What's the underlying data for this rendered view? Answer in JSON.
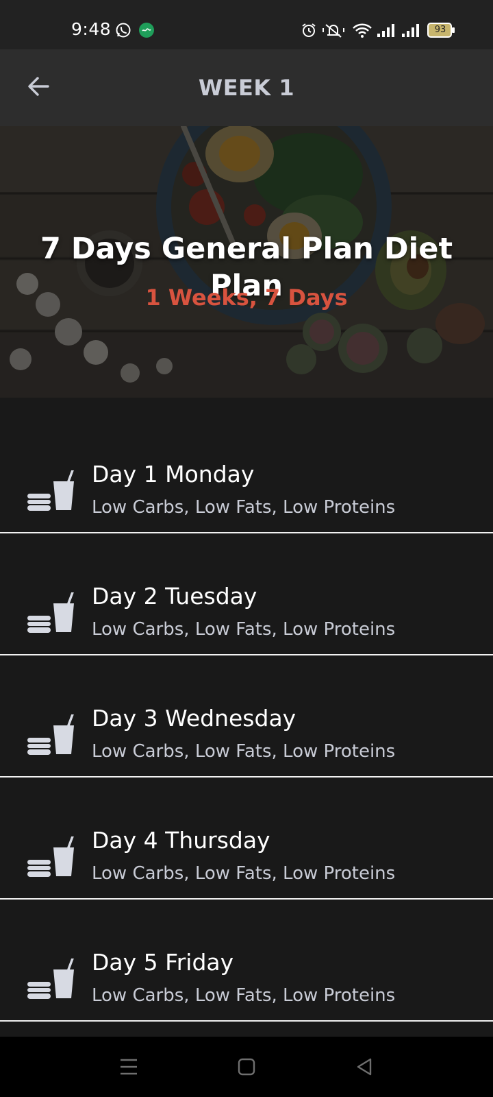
{
  "status_bar": {
    "time": "9:48",
    "battery": "93",
    "icons": [
      "whatsapp-icon",
      "app-notification-icon",
      "alarm-icon",
      "mute-icon",
      "wifi-icon",
      "signal-icon",
      "signal-icon",
      "battery-icon"
    ]
  },
  "header": {
    "title": "WEEK 1",
    "back_icon": "arrow-left-icon"
  },
  "hero": {
    "title": "7 Days General Plan Diet Plan",
    "subtitle": "1 Weeks, 7 Days",
    "subtitle_color": "#d8533f"
  },
  "days": [
    {
      "title": "Day 1 Monday",
      "subtitle": "Low Carbs, Low Fats, Low Proteins"
    },
    {
      "title": "Day 2 Tuesday",
      "subtitle": "Low Carbs, Low Fats, Low Proteins"
    },
    {
      "title": "Day 3 Wednesday",
      "subtitle": "Low Carbs, Low Fats, Low Proteins"
    },
    {
      "title": "Day 4 Thursday",
      "subtitle": "Low Carbs, Low Fats, Low Proteins"
    },
    {
      "title": "Day 5 Friday",
      "subtitle": "Low Carbs, Low Fats, Low Proteins"
    }
  ],
  "day_icon": "burger-drink-icon",
  "nav_bar": {
    "icons": [
      "menu-icon",
      "home-icon",
      "back-triangle-icon"
    ]
  },
  "colors": {
    "background": "#191919",
    "app_bar": "#2d2d2d",
    "accent": "#d8533f",
    "muted_text": "#c9ccd6"
  }
}
